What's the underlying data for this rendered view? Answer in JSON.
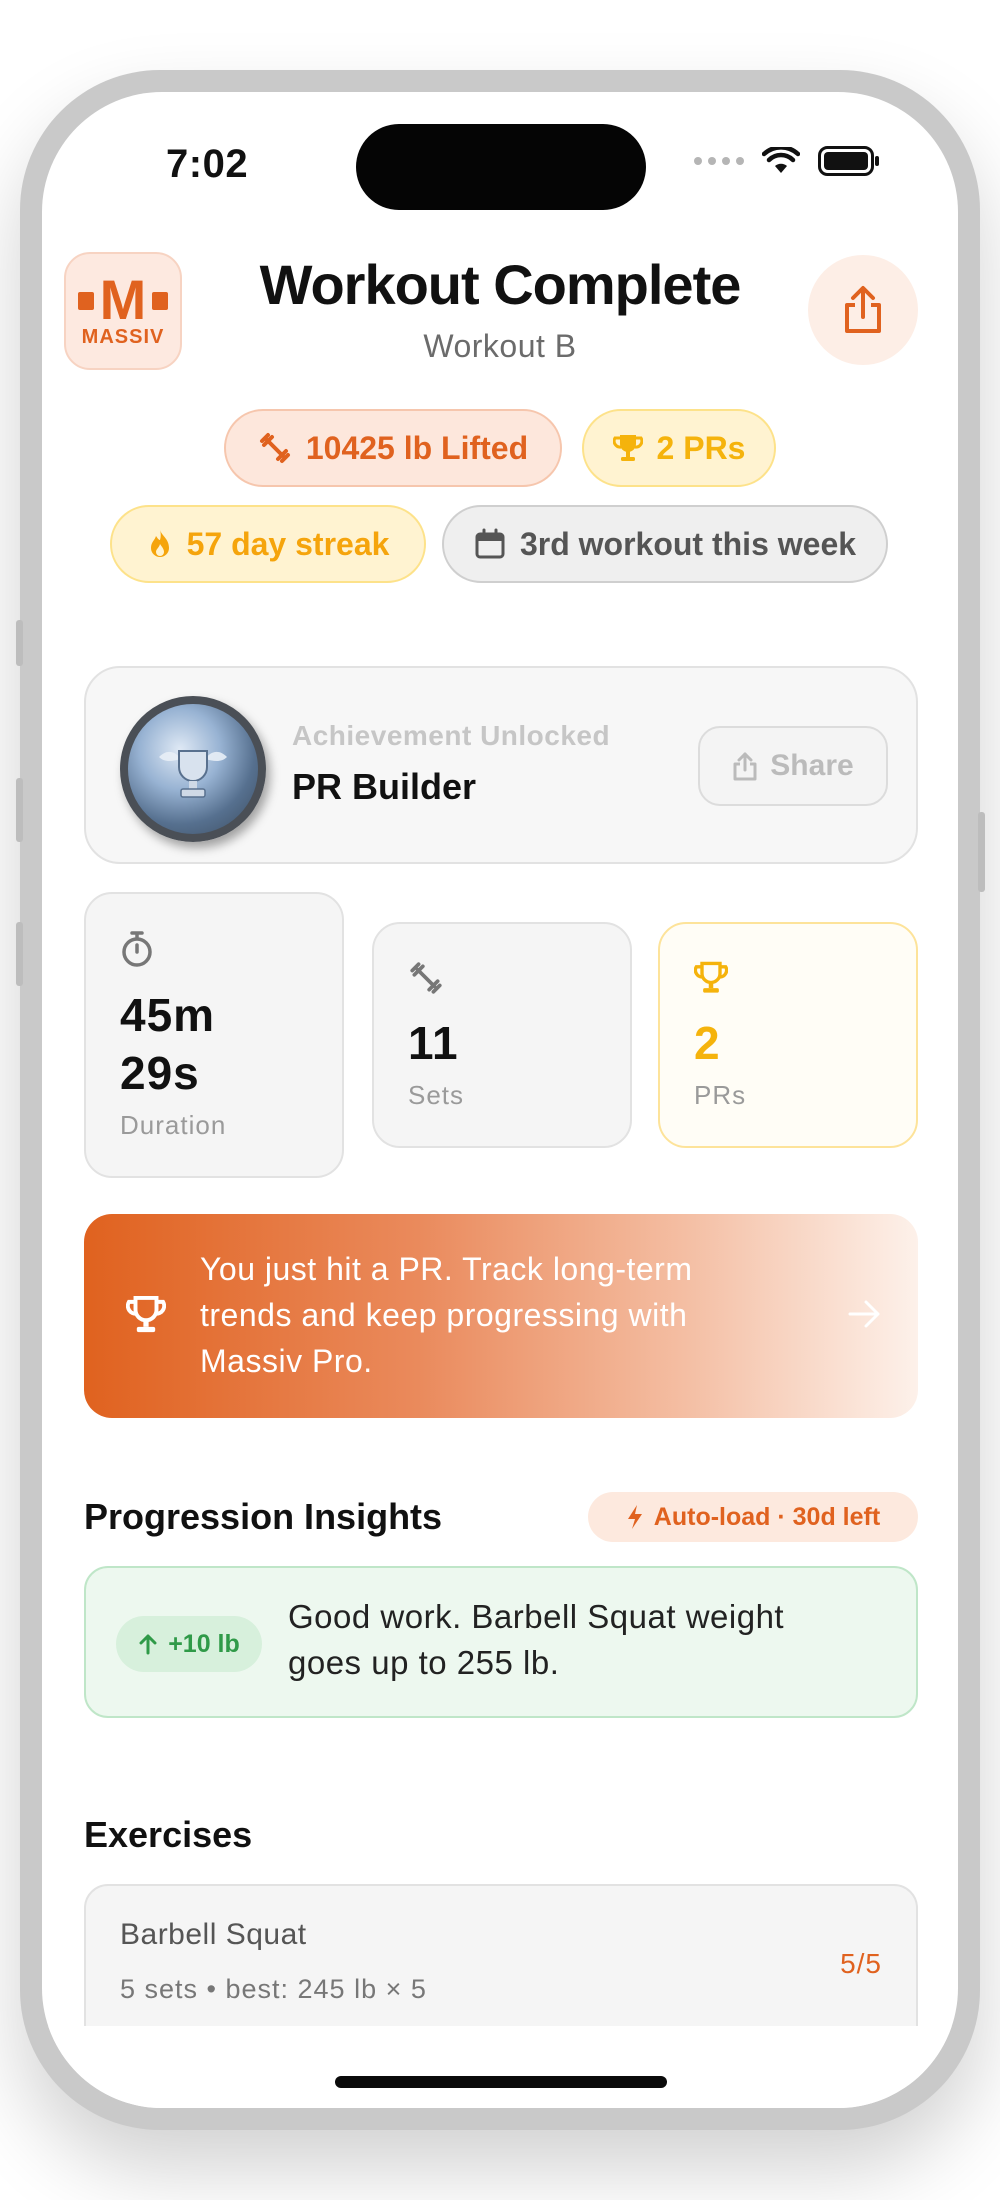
{
  "status_bar": {
    "time": "7:02"
  },
  "header": {
    "logo_text": "MASSIV",
    "title": "Workout Complete",
    "subtitle": "Workout B"
  },
  "chips": {
    "lifted": "10425 lb Lifted",
    "prs": "2 PRs",
    "streak": "57 day streak",
    "week": "3rd workout this week"
  },
  "achievement": {
    "label": "Achievement Unlocked",
    "name": "PR Builder",
    "share_label": "Share"
  },
  "stats": {
    "duration_value": "45m 29s",
    "duration_label": "Duration",
    "sets_value": "11",
    "sets_label": "Sets",
    "prs_value": "2",
    "prs_label": "PRs"
  },
  "promo": {
    "text": "You just hit a PR. Track long-term trends and keep progressing with Massiv Pro."
  },
  "insights": {
    "title": "Progression Insights",
    "badge": "Auto-load · 30d left",
    "delta": "+10 lb",
    "message": "Good work. Barbell Squat weight goes up to 255 lb."
  },
  "exercises": {
    "title": "Exercises",
    "items": [
      {
        "name": "Barbell Squat",
        "meta": "5 sets  •  best: 245 lb × 5",
        "count": "5/5"
      }
    ]
  },
  "colors": {
    "accent": "#e0621f",
    "gold": "#f5b30c",
    "success": "#2f9a48"
  }
}
